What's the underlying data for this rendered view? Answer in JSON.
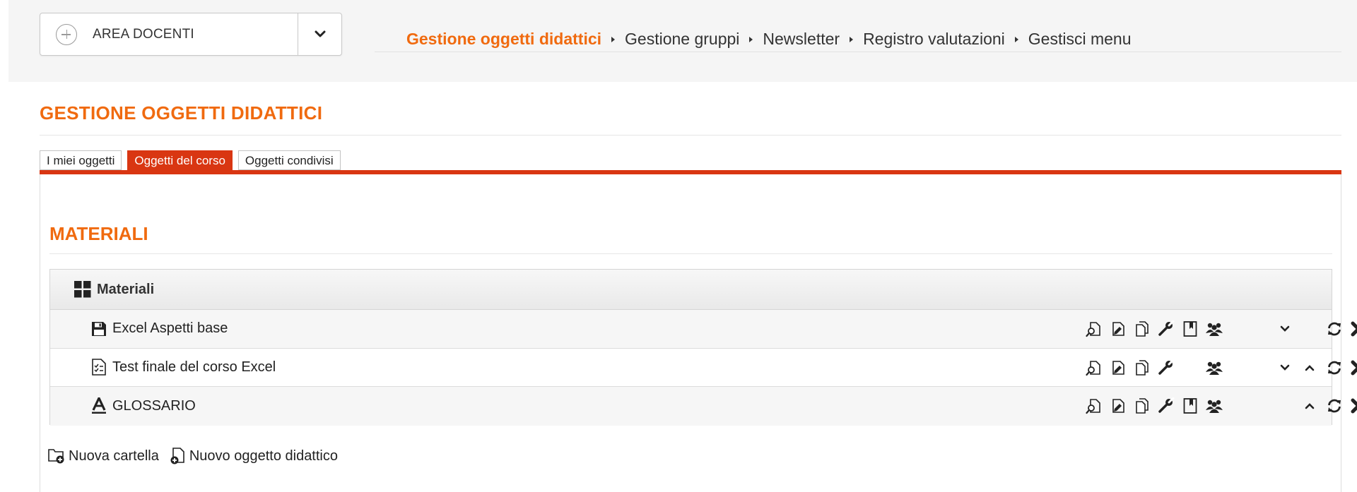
{
  "area_select": {
    "label": "AREA DOCENTI"
  },
  "breadcrumb": [
    {
      "label": "Gestione oggetti didattici",
      "active": true
    },
    {
      "label": "Gestione gruppi"
    },
    {
      "label": "Newsletter"
    },
    {
      "label": "Registro valutazioni"
    },
    {
      "label": "Gestisci menu"
    }
  ],
  "page_title": "GESTIONE OGGETTI DIDATTICI",
  "tabs": [
    {
      "label": "I miei oggetti"
    },
    {
      "label": "Oggetti del corso",
      "active": true
    },
    {
      "label": "Oggetti condivisi"
    }
  ],
  "section_title": "MATERIALI",
  "folder": {
    "name": "Materiali",
    "icon": "grid-icon"
  },
  "items": [
    {
      "title": "Excel Aspetti base",
      "icon": "floppy-disk-icon",
      "actions": [
        "preview-icon",
        "edit-icon",
        "copy-icon",
        "wrench-icon",
        "bookmark-icon",
        "group-icon",
        "move-down-icon",
        "refresh-icon",
        "delete-icon"
      ]
    },
    {
      "title": "Test finale del corso Excel",
      "icon": "checklist-icon",
      "actions": [
        "preview-icon",
        "edit-icon",
        "copy-icon",
        "wrench-icon",
        "group-icon",
        "move-down-icon",
        "move-up-icon",
        "refresh-icon",
        "delete-icon"
      ]
    },
    {
      "title": "GLOSSARIO",
      "icon": "glossary-icon",
      "actions": [
        "preview-icon",
        "edit-icon",
        "copy-icon",
        "wrench-icon",
        "bookmark-icon",
        "group-icon",
        "move-up-icon",
        "refresh-icon",
        "delete-icon"
      ]
    }
  ],
  "footer": {
    "new_folder": "Nuova cartella",
    "new_object": "Nuovo oggetto didattico"
  },
  "colors": {
    "accent": "#f06a0f",
    "tab_active": "#d93612"
  }
}
